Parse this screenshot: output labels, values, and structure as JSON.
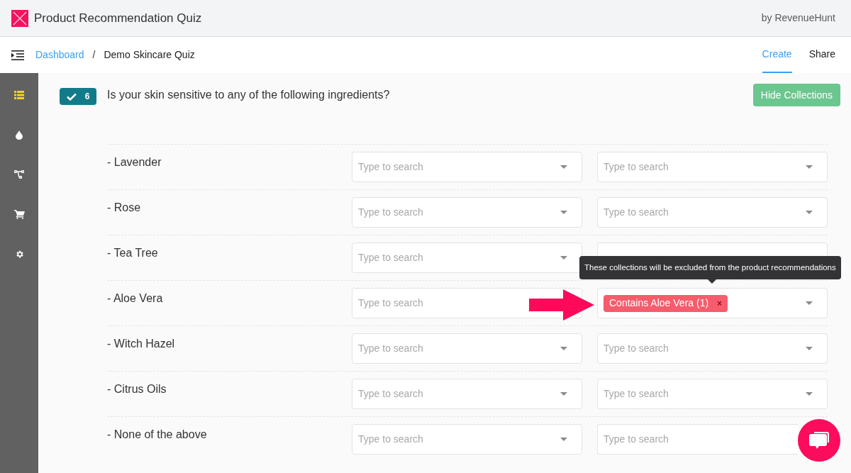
{
  "header": {
    "title": "Product Recommendation Quiz",
    "by": "by RevenueHunt"
  },
  "breadcrumb": {
    "link": "Dashboard",
    "separator": "/",
    "current": "Demo Skincare Quiz"
  },
  "tabs": [
    {
      "label": "Create",
      "selected": true
    },
    {
      "label": "Share",
      "selected": false
    }
  ],
  "sidebar": {
    "items": [
      {
        "kind": "list",
        "selected": true
      },
      {
        "kind": "drop",
        "selected": false
      },
      {
        "kind": "flow",
        "selected": false
      },
      {
        "kind": "cart",
        "selected": false
      },
      {
        "kind": "gear",
        "selected": false
      }
    ]
  },
  "question": {
    "number": "6",
    "done": true,
    "text": "Is your skin sensitive to any of the following ingredients?",
    "button": "Hide Collections"
  },
  "rows": [
    {
      "label": "- Lavender",
      "left": {
        "placeholder": "Type to search"
      },
      "right": {
        "placeholder": "Type to search"
      }
    },
    {
      "label": "- Rose",
      "left": {
        "placeholder": "Type to search"
      },
      "right": {
        "placeholder": "Type to search"
      }
    },
    {
      "label": "- Tea Tree",
      "left": {
        "placeholder": "Type to search"
      },
      "right": {}
    },
    {
      "label": "- Aloe Vera",
      "left": {
        "placeholder": "Type to search"
      },
      "right": {
        "tags": [
          {
            "label": "Contains Aloe Vera (1)",
            "remove": "×"
          }
        ]
      },
      "tooltip": "These collections will be excluded from the product recommendations"
    },
    {
      "label": "- Witch Hazel",
      "left": {
        "placeholder": "Type to search"
      },
      "right": {
        "placeholder": "Type to search"
      }
    },
    {
      "label": "- Citrus Oils",
      "left": {
        "placeholder": "Type to search"
      },
      "right": {
        "placeholder": "Type to search"
      }
    },
    {
      "label": "- None of the above",
      "left": {
        "placeholder": "Type to search"
      },
      "right": {
        "placeholder": "Type to search"
      }
    }
  ]
}
